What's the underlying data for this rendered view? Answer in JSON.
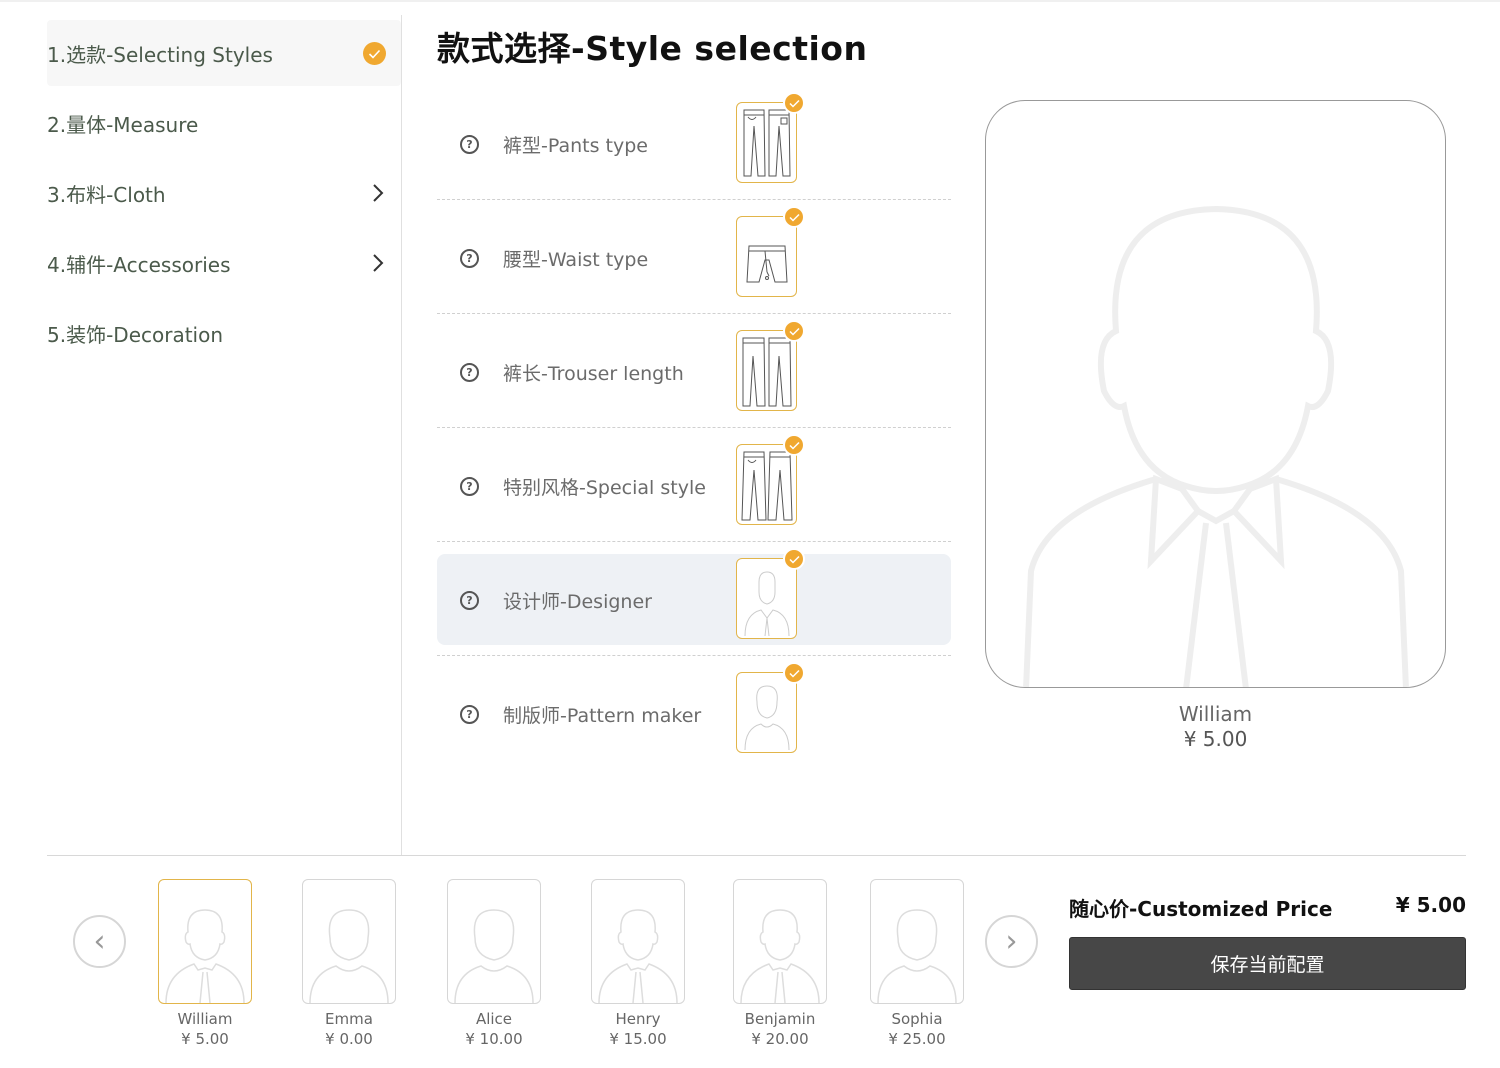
{
  "sidebar": {
    "items": [
      {
        "label": "1.选款-Selecting Styles",
        "state": "completed"
      },
      {
        "label": "2.量体-Measure"
      },
      {
        "label": "3.布料-Cloth",
        "has_submenu": true
      },
      {
        "label": "4.辅件-Accessories",
        "has_submenu": true
      },
      {
        "label": "5.装饰-Decoration"
      }
    ]
  },
  "main": {
    "title": "款式选择-Style selection",
    "options": [
      {
        "label": "裤型-Pants type",
        "icon": "pants-front-back-icon"
      },
      {
        "label": "腰型-Waist type",
        "icon": "waist-icon"
      },
      {
        "label": "裤长-Trouser length",
        "icon": "trouser-length-icon"
      },
      {
        "label": "特别风格-Special style",
        "icon": "special-style-icon"
      },
      {
        "label": "设计师-Designer",
        "icon": "designer-avatar-icon",
        "selected": true
      },
      {
        "label": "制版师-Pattern maker",
        "icon": "pattern-maker-avatar-icon"
      }
    ]
  },
  "preview": {
    "name": "William",
    "price": "¥ 5.00"
  },
  "carousel": {
    "prev": "‹",
    "next": "›",
    "designers": [
      {
        "name": "William",
        "price": "¥ 5.00",
        "avatar": "male",
        "active": true
      },
      {
        "name": "Emma",
        "price": "¥ 0.00",
        "avatar": "female"
      },
      {
        "name": "Alice",
        "price": "¥ 10.00",
        "avatar": "female"
      },
      {
        "name": "Henry",
        "price": "¥ 15.00",
        "avatar": "male"
      },
      {
        "name": "Benjamin",
        "price": "¥ 20.00",
        "avatar": "male"
      },
      {
        "name": "Sophia",
        "price": "¥ 25.00",
        "avatar": "female"
      }
    ]
  },
  "summary": {
    "price_label": "随心价-Customized Price",
    "price_value": "¥ 5.00",
    "save_label": "保存当前配置"
  },
  "colors": {
    "accent": "#f0a830",
    "thumb_border": "#e2b54a",
    "save_button": "#474747",
    "selected_row": "#eef1f5"
  }
}
